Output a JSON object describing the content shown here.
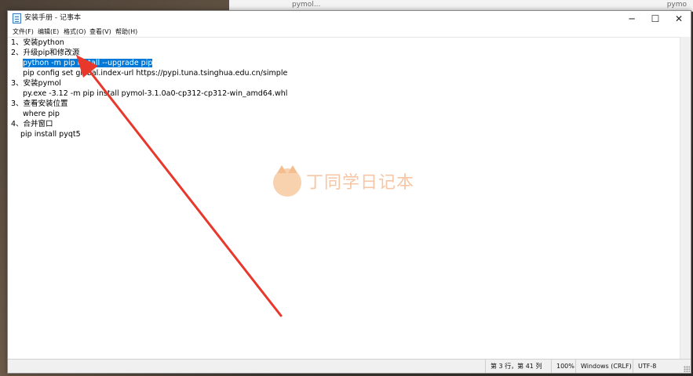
{
  "app": {
    "title": "安装手册 - 记事本",
    "background_window_title": "pymol...",
    "background_window_right": "pymo"
  },
  "window_controls": {
    "minimize": "─",
    "maximize": "☐",
    "close": "✕"
  },
  "menu": [
    {
      "label": "文件(F)"
    },
    {
      "label": "编辑(E)"
    },
    {
      "label": "格式(O)"
    },
    {
      "label": "查看(V)"
    },
    {
      "label": "帮助(H)"
    }
  ],
  "document": {
    "lines": [
      {
        "text": "1、安装python",
        "indent": 0
      },
      {
        "text": "2、升级pip和修改源",
        "indent": 0
      },
      {
        "text": "python -m pip install --upgrade pip",
        "indent": 1,
        "selected": true
      },
      {
        "text": "pip config set global.index-url https://pypi.tuna.tsinghua.edu.cn/simple",
        "indent": 1
      },
      {
        "text": "3、安装pymol",
        "indent": 0
      },
      {
        "text": "py.exe -3.12 -m pip install pymol-3.1.0a0-cp312-cp312-win_amd64.whl",
        "indent": 1
      },
      {
        "text": "3、查看安装位置",
        "indent": 0
      },
      {
        "text": "where pip",
        "indent": 1
      },
      {
        "text": "4、合并窗口",
        "indent": 0
      },
      {
        "text": "pip install pyqt5",
        "indent": 1
      }
    ]
  },
  "status": {
    "position": "第 3 行，第 41 列",
    "zoom": "100%",
    "line_ending": "Windows (CRLF)",
    "encoding": "UTF-8"
  },
  "watermark": {
    "text": "丁同学日记本"
  },
  "colors": {
    "selection": "#0078d7",
    "arrow": "#e8372b"
  }
}
